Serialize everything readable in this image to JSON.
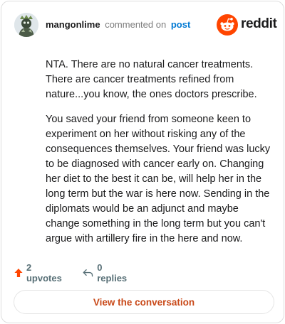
{
  "header": {
    "username": "mangonlime",
    "action_text": "commented on",
    "post_link": "post",
    "brand_name": "reddit"
  },
  "comment": {
    "paragraphs": [
      "NTA. There are no natural cancer treatments. There are cancer treatments refined from nature...you know, the ones doctors prescribe.",
      "You saved your friend from someone keen to experiment on her without risking any of the consequences themselves. Your friend was lucky to be diagnosed with cancer early on. Changing her diet to the best it can be, will help her in the long term but the war is here now. Sending in the diplomats would be an adjunct and maybe change something in the long term but you can't argue with artillery fire in the here and now."
    ]
  },
  "footer": {
    "upvotes": "2 upvotes",
    "replies": "0 replies",
    "cta_label": "View the conversation"
  },
  "colors": {
    "brand": "#ff4500",
    "link": "#0079d3",
    "cta_text": "#c94a1a",
    "muted": "#576f76"
  },
  "icons": [
    "avatar-image",
    "reddit-logo-icon",
    "upvote-arrow-icon",
    "reply-arrow-icon"
  ]
}
